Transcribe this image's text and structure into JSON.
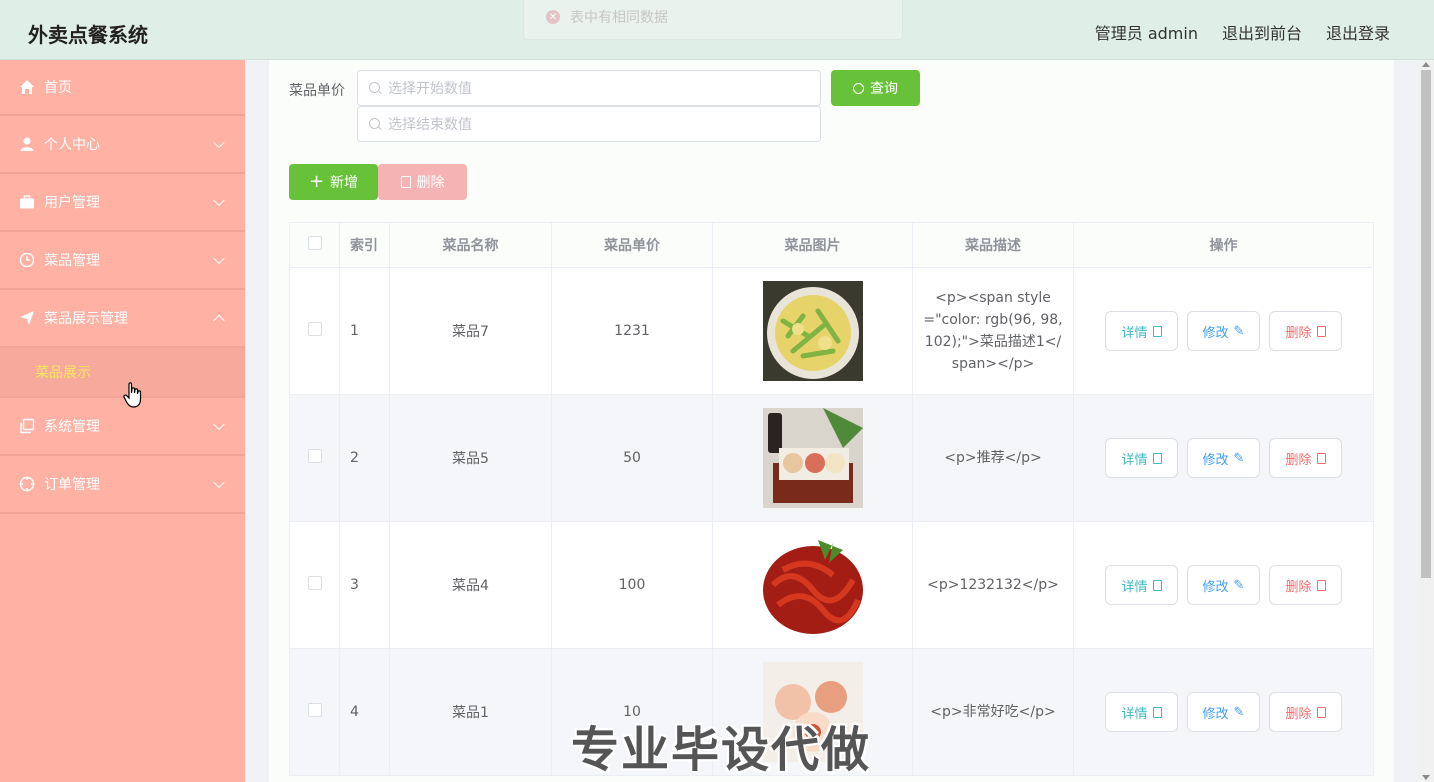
{
  "header": {
    "logo": "外卖点餐系统",
    "user": "管理员 admin",
    "to_front": "退出到前台",
    "logout": "退出登录"
  },
  "toast": {
    "message": "表中有相同数据"
  },
  "sidebar": {
    "items": [
      {
        "label": "首页",
        "icon": "home-icon"
      },
      {
        "label": "个人中心",
        "icon": "user-icon"
      },
      {
        "label": "用户管理",
        "icon": "briefcase-icon"
      },
      {
        "label": "菜品管理",
        "icon": "clock-icon"
      },
      {
        "label": "菜品展示管理",
        "icon": "send-icon"
      },
      {
        "label": "系统管理",
        "icon": "copy-icon"
      },
      {
        "label": "订单管理",
        "icon": "target-icon"
      }
    ],
    "active_sub": "菜品展示"
  },
  "search": {
    "label": "菜品单价",
    "start_placeholder": "选择开始数值",
    "end_placeholder": "选择结束数值",
    "query_button": "查询"
  },
  "actions": {
    "add": "新增",
    "delete": "删除"
  },
  "table": {
    "headers": [
      "索引",
      "菜品名称",
      "菜品单价",
      "菜品图片",
      "菜品描述",
      "操作"
    ],
    "rows": [
      {
        "index": "1",
        "name": "菜品7",
        "price": "1231",
        "desc": "<p><span style=\"color: rgb(96, 98, 102);\">菜品描述1</span></p>"
      },
      {
        "index": "2",
        "name": "菜品5",
        "price": "50",
        "desc": "<p>推荐</p>"
      },
      {
        "index": "3",
        "name": "菜品4",
        "price": "100",
        "desc": "<p>1232132</p>"
      },
      {
        "index": "4",
        "name": "菜品1",
        "price": "10",
        "desc": "<p>非常好吃</p>"
      }
    ],
    "ops": {
      "detail": "详情",
      "edit": "修改",
      "remove": "删除"
    }
  },
  "watermark": "专业毕设代做"
}
